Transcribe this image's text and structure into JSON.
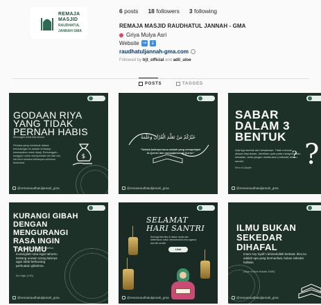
{
  "profile": {
    "logo_line1": "REMAJA",
    "logo_line2": "MASJID",
    "logo_line3": "RAUDHATUL JANNAH GMA",
    "posts_count": "6",
    "posts_label": "posts",
    "followers_count": "18",
    "followers_label": "followers",
    "following_count": "3",
    "following_label": "following",
    "name": "REMAJA MASJID RAUDHATUL JANNAH - GMA",
    "location": "Griya Mulya Asri",
    "website_label": "Website",
    "website_emoji_1": "→",
    "website_emoji_2": "↓",
    "link": "raudhatuljannah-gma.com",
    "followed_by_prefix": "Followed by",
    "followed_by_user1": "trjt_official",
    "followed_by_and": "and",
    "followed_by_user2": "adil_uloe"
  },
  "tabs": [
    {
      "label": "POSTS",
      "active": true
    },
    {
      "label": "TAGGED",
      "active": false
    }
  ],
  "posts": [
    {
      "title": "GODAAN RIYA YANG TIDAK PERNAH HABIS",
      "sub": "Renungan untuk kita semua",
      "body": "Perkara yang membuat dakwa terkadangan ini adalah terhadap kesempatan untuk dipuji. Bersungguh-sungguh untuk memperbaiki diri dari hal-hal kecil selama kehidupan sebelum terlambat.",
      "footer": "@remasraudhatuljannah_gma"
    },
    {
      "arabic": "خَيْرُكُمْ مَنْ تَعَلَّمَ الْقُرْآنَ وَعَلَّمَهُ",
      "quote": "\"Sebaik-baiknya kamu adalah yang mempelajari Al-Qur'an dan mengajarkan al-Qur'an\"",
      "footer": "@remasraudhatuljannah_gma"
    },
    {
      "title": "SABAR DALAM 3 BENTUK",
      "body": "Ada tiga bentuk dari kesabaran: Tidak mencari alasan keputusan, demikian pula pada mengamalkan ketaatan, serta jangan melakukan (maksiat) dirimu sendiri.",
      "src": "Ibnu al-Qayyim",
      "footer": "@remasraudhatuljannah_gma"
    },
    {
      "title": "KURANGI GIBAH DENGAN MENGURANGI RASA INGIN TAHUMU",
      "sub": "Jadilah Mu'minah seperti berikut",
      "body": "Kurangilah rasa ingin tahumu tentang urusan orang lainnya agar tidak berkurang perbuatan gibahmu.",
      "src": "Ibn Hajar (1/53)",
      "footer": "@remasraudhatuljannah_gma"
    },
    {
      "script_line1": "SELAMAT",
      "script_line2": "HARI SANTRI",
      "body": "Semoga kita tiba di dalam dunia dan keterhasan untuk menuntunkan ilmu agama dari diri sendiri.",
      "button": "Lihat Selengkapnya",
      "footer": "@remasraudhatuljannah_gma"
    },
    {
      "title": "ILMU BUKAN SEKEDAR DIHAFAL",
      "body": "Imam Asy Syafi'i rahimahullah berkata: Ilmu itu adalah apa yang bermanfaat, bukan sekedar hafalan.",
      "src": "(Siyar A'lamin Nubala 10/89)",
      "footer": "@remasraudhatuljannah_gma"
    }
  ]
}
